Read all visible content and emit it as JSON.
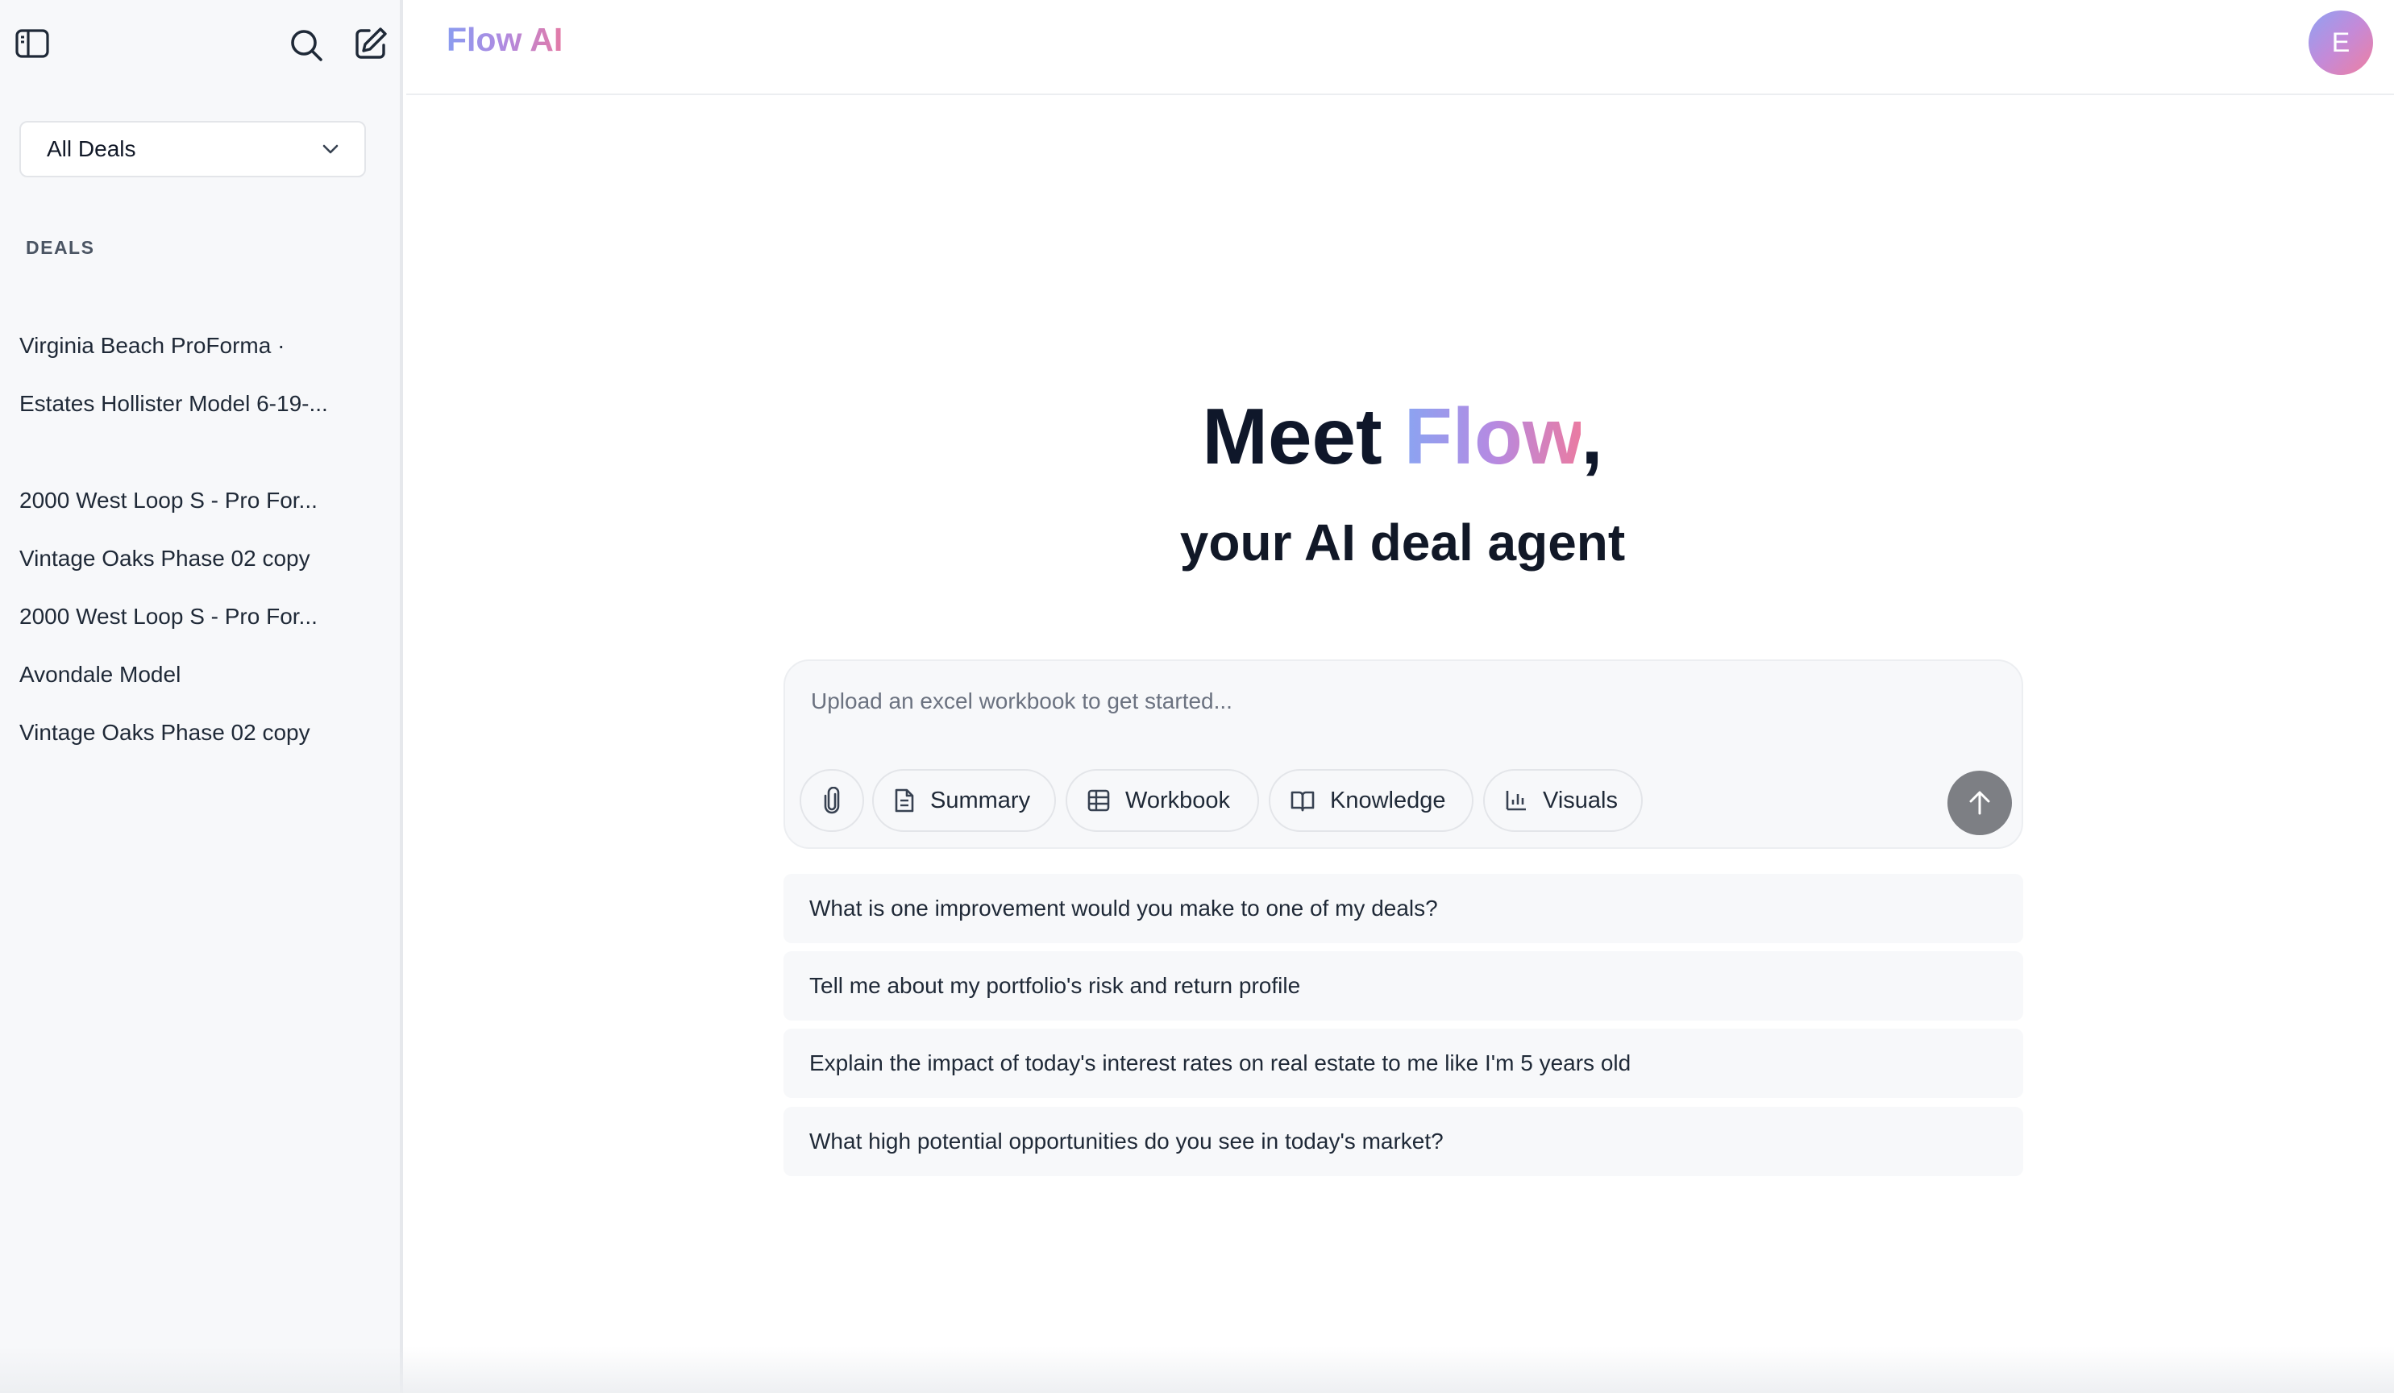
{
  "brand": {
    "name": "Flow AI"
  },
  "sidebar": {
    "deal_filter": {
      "selected": "All Deals"
    },
    "section_label": "DEALS",
    "deals": [
      {
        "label": "Virginia Beach ProForma ·"
      },
      {
        "label": "Estates Hollister Model 6-19-..."
      },
      {
        "label": "2000 West Loop S - Pro For..."
      },
      {
        "label": "Vintage Oaks Phase 02 copy"
      },
      {
        "label": "2000 West Loop S - Pro For..."
      },
      {
        "label": "Avondale Model"
      },
      {
        "label": "Vintage Oaks Phase 02 copy"
      }
    ]
  },
  "user": {
    "avatar_initial": "E"
  },
  "hero": {
    "line1_prefix": "Meet ",
    "line1_highlight": "Flow",
    "line1_suffix": ",",
    "line2": "your AI deal agent"
  },
  "composer": {
    "placeholder": "Upload an excel workbook to get started...",
    "chips": [
      {
        "label": "Summary",
        "icon": "document-icon"
      },
      {
        "label": "Workbook",
        "icon": "table-icon"
      },
      {
        "label": "Knowledge",
        "icon": "book-icon"
      },
      {
        "label": "Visuals",
        "icon": "bar-chart-icon"
      }
    ]
  },
  "suggestions": [
    {
      "text": "What is one improvement would you make to one of my deals?"
    },
    {
      "text": "Tell me about my portfolio's risk and return profile"
    },
    {
      "text": "Explain the impact of today's interest rates on real estate to me like I'm 5 years old"
    },
    {
      "text": "What high potential opportunities do you see in today's market?"
    }
  ],
  "colors": {
    "accent_gradient_start": "#8aa4f2",
    "accent_gradient_end": "#ea7ba2",
    "sidebar_bg": "#f7f8fa",
    "send_button": "#7d7f84"
  }
}
